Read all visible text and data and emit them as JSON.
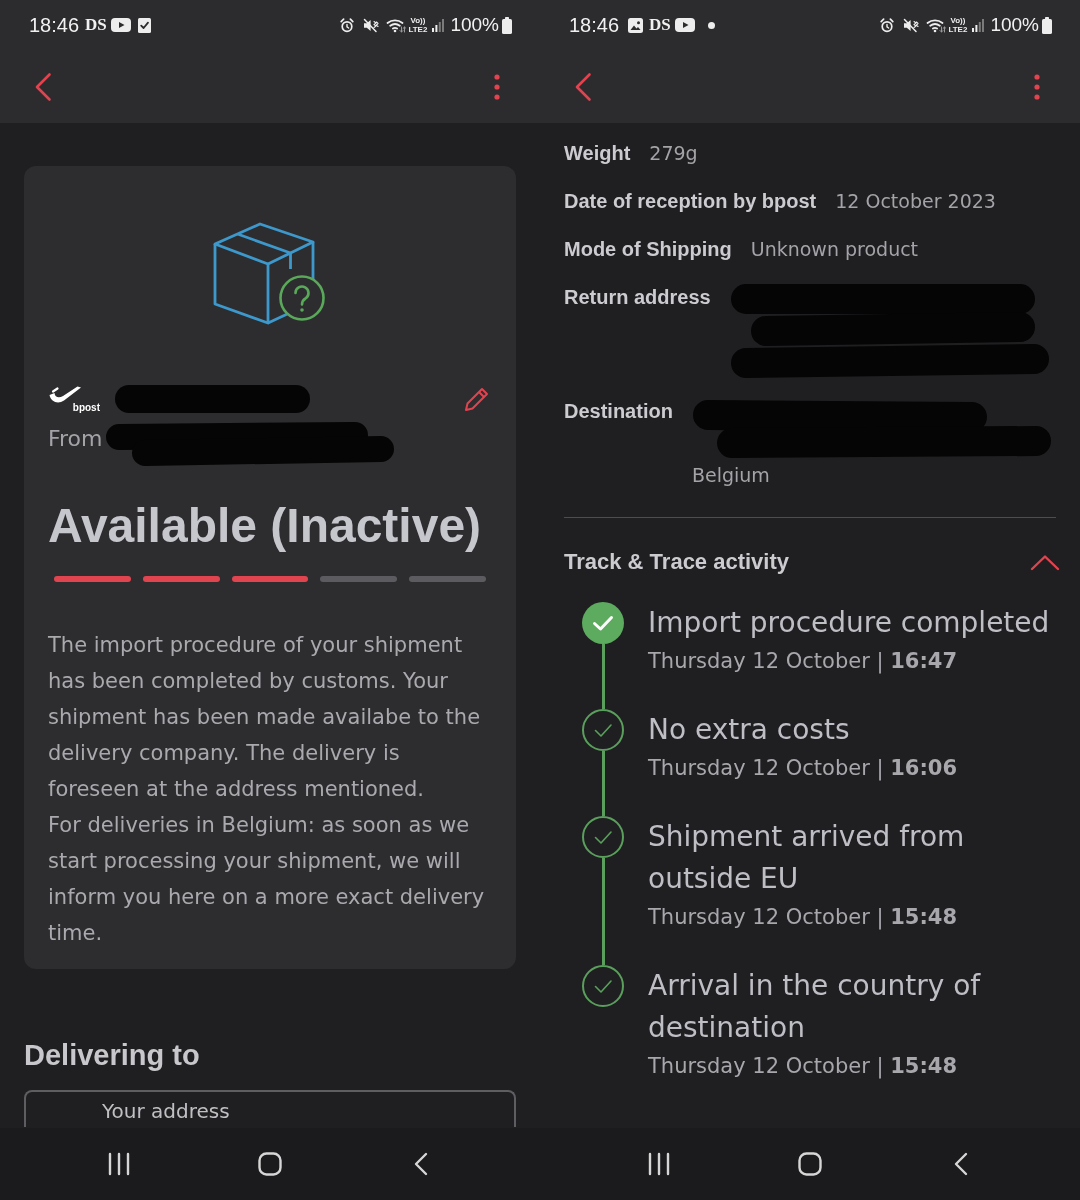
{
  "shipment_status_screen": {
    "status_bar": {
      "time": "18:46",
      "notifications": [
        {
          "kind": "app_text",
          "text": "DS"
        },
        {
          "kind": "video"
        },
        {
          "kind": "checklist"
        }
      ],
      "volte_label": "Vo))",
      "network_label": "LTE2",
      "battery_percent": "100%"
    },
    "shipment_card": {
      "carrier_logo_text": "bpost",
      "sender_redacted": true,
      "from_label": "From",
      "from_redacted": true,
      "status_title": "Available (Inactive)",
      "progress_steps": [
        {
          "done": true
        },
        {
          "done": true
        },
        {
          "done": true
        },
        {
          "done": false
        },
        {
          "done": false
        }
      ],
      "description": [
        "The import procedure of your shipment has been completed by customs. Your shipment has been made availabe to the delivery company. The delivery is foreseen at the address mentioned.",
        "For deliveries in Belgium: as soon as we start processing your shipment, we will inform you here on a more exact delivery time."
      ]
    },
    "delivering_to": {
      "heading": "Delivering to",
      "address_label": "Your address"
    }
  },
  "shipment_details_screen": {
    "status_bar": {
      "time": "18:46",
      "notifications": [
        {
          "kind": "image"
        },
        {
          "kind": "app_text",
          "text": "DS"
        },
        {
          "kind": "video"
        },
        {
          "kind": "dot"
        }
      ],
      "volte_label": "Vo))",
      "network_label": "LTE2",
      "battery_percent": "100%"
    },
    "details": [
      {
        "label": "Weight",
        "value": "279g",
        "redacted": false
      },
      {
        "label": "Date of reception by bpost",
        "value": "12 October 2023",
        "redacted": false
      },
      {
        "label": "Mode of Shipping",
        "value": "Unknown product",
        "redacted": false
      },
      {
        "label": "Return address",
        "redacted": true
      },
      {
        "label": "Destination",
        "value": "Belgium",
        "redacted": true
      }
    ],
    "track_and_trace": {
      "title": "Track & Trace activity",
      "expanded": true,
      "events": [
        {
          "title": "Import procedure completed",
          "time": "Thursday 12 October | **16:47**",
          "latest": true
        },
        {
          "title": "No extra costs",
          "time": "Thursday 12 October | **16:06**",
          "latest": false
        },
        {
          "title": "Shipment arrived from outside EU",
          "time": "Thursday 12 October | **15:48**",
          "latest": false
        },
        {
          "title": "Arrival in the country of destination",
          "time": "Thursday 12 October | **15:48**",
          "latest": false
        }
      ]
    }
  }
}
